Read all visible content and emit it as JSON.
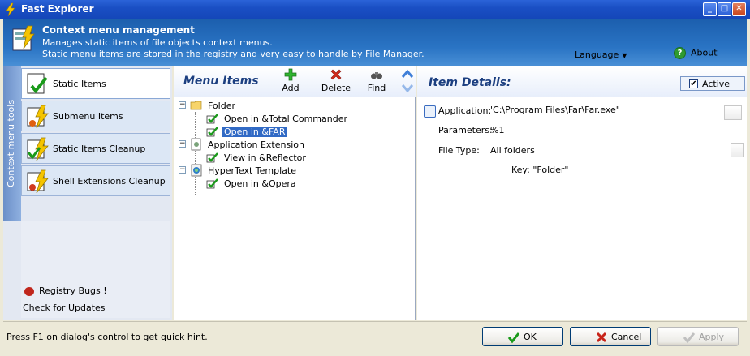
{
  "window": {
    "title": "Fast Explorer"
  },
  "header": {
    "title": "Context menu management",
    "subtitle1": "Manages static items of file objects context menus.",
    "subtitle2": "Static menu items are stored in the registry and very easy to handle by File Manager.",
    "language": "Language",
    "about": "About"
  },
  "sidebar": {
    "strip_label": "Context menu tools",
    "items": [
      {
        "label": "Static Items",
        "active": true
      },
      {
        "label": "Submenu Items"
      },
      {
        "label": "Static Items Cleanup"
      },
      {
        "label": "Shell Extensions Cleanup"
      }
    ],
    "registry_bugs": "Registry Bugs !",
    "check_updates": "Check for Updates"
  },
  "menu_items": {
    "title": "Menu Items",
    "toolbar": {
      "add": "Add",
      "delete": "Delete",
      "find": "Find"
    },
    "tree": [
      {
        "label": "Folder",
        "children": [
          "Open in &Total Commander",
          "Open in &FAR"
        ]
      },
      {
        "label": "Application Extension",
        "children": [
          "View in &Reflector"
        ]
      },
      {
        "label": "HyperText Template",
        "children": [
          "Open in &Opera"
        ]
      }
    ],
    "selected": "Open in &FAR"
  },
  "details": {
    "title": "Item Details:",
    "active_label": "Active",
    "application_label": "Application:",
    "application_value": "'C:\\Program Files\\Far\\Far.exe\"",
    "parameters_label": "Parameters:",
    "parameters_value": "%1",
    "filetype_label": "File Type:",
    "filetype_value": "All folders",
    "key_value": "Key: \"Folder\""
  },
  "status": {
    "hint": "Press F1 on dialog's control to get quick hint.",
    "ok": "OK",
    "cancel": "Cancel",
    "apply": "Apply"
  }
}
